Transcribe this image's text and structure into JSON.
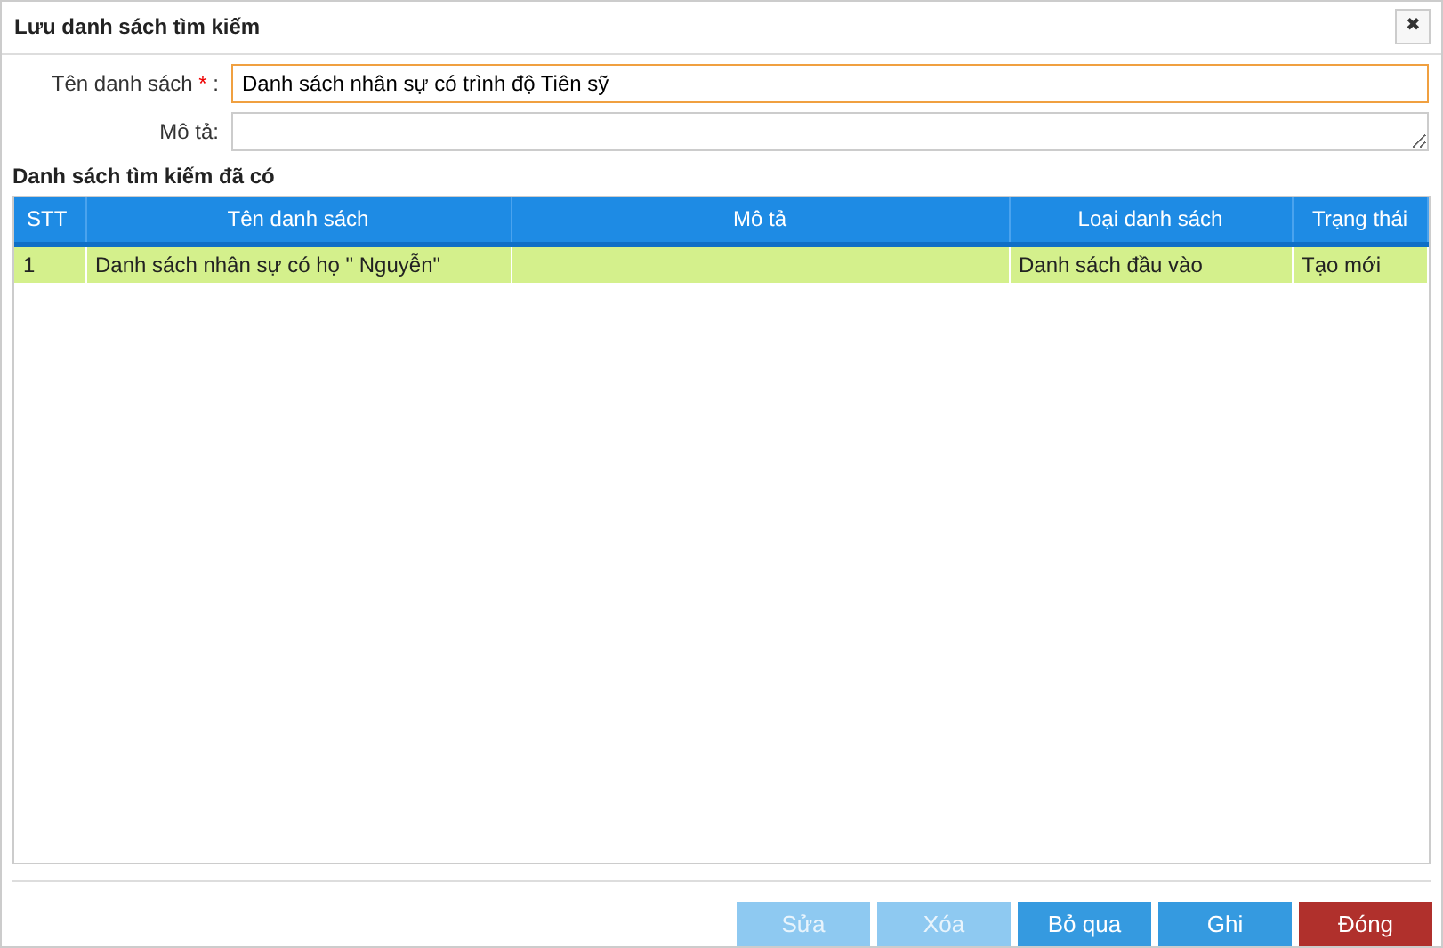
{
  "window": {
    "title": "Lưu danh sách tìm kiếm",
    "close": "✖"
  },
  "form": {
    "fields": [
      {
        "label": "Tên danh sách",
        "required_mark": "*",
        "separator": ":",
        "value": "Danh sách nhân sự có trình độ Tiên sỹ",
        "focused": true,
        "kind": "input"
      },
      {
        "label": "Mô tả:",
        "focused": false,
        "kind": "textarea"
      }
    ]
  },
  "section_title": "Danh sách tìm kiếm đã có",
  "table": {
    "columns": [
      "STT",
      "Tên danh sách",
      "Mô tả",
      "Loại danh sách",
      "Trạng thái"
    ],
    "rows": [
      {
        "cells": [
          "1",
          "Danh sách nhân sự có họ \" Nguyễn\"",
          "",
          "Danh sách đầu vào",
          "Tạo mới"
        ],
        "selected": true
      }
    ]
  },
  "buttons": [
    {
      "label": "Sửa",
      "kind": "primary",
      "disabled": true
    },
    {
      "label": "Xóa",
      "kind": "primary",
      "disabled": true
    },
    {
      "label": "Bỏ qua",
      "kind": "primary",
      "disabled": false
    },
    {
      "label": "Ghi",
      "kind": "primary",
      "disabled": false
    },
    {
      "label": "Đóng",
      "kind": "danger",
      "disabled": false
    }
  ]
}
